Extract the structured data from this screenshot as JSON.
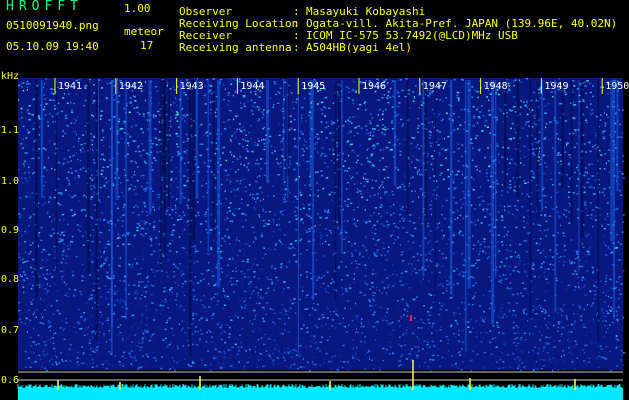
{
  "app": {
    "title": "HROFFT",
    "version": "1.00"
  },
  "file": {
    "name": "0510091940.png",
    "datetime": "05.10.09 19:40"
  },
  "meteor": {
    "label": "meteor",
    "count": "17"
  },
  "info": [
    {
      "key": "Observer",
      "sep": ":",
      "value": "Masayuki Kobayashi"
    },
    {
      "key": "Receiving Location",
      "sep": ":",
      "value": "Ogata-vill. Akita-Pref. JAPAN (139.96E, 40.02N)"
    },
    {
      "key": "Receiver",
      "sep": ":",
      "value": "ICOM IC-575 53.7492(@LCD)MHz USB"
    },
    {
      "key": "Receiving antenna",
      "sep": ":",
      "value": "A504HB(yagi 4el)"
    }
  ],
  "axis": {
    "unit": "kHz",
    "y_ticks": [
      "1.1",
      "1.0",
      "0.9",
      "0.8",
      "0.7",
      "0.6"
    ],
    "minute_ticks": [
      "1941",
      "1942",
      "1943",
      "1944",
      "1945",
      "1946",
      "1947",
      "1948",
      "1949",
      "1950"
    ]
  },
  "colors": {
    "label": "#ffff00",
    "bg": "#000000",
    "noise_base": "#0a1a8c",
    "trace": "#00ffff"
  }
}
